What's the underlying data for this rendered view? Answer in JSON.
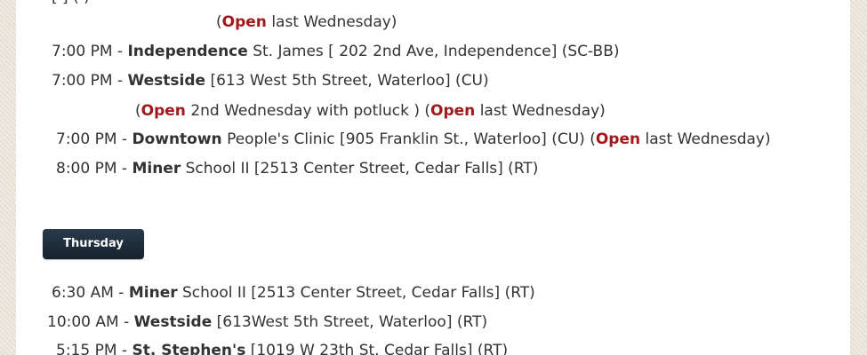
{
  "open_label": "Open",
  "top_cut_line": {
    "text": "                                      [                                ]  (  )"
  },
  "wednesday_items": [
    {
      "tail": "last Wednesday)"
    },
    {
      "time": "7:00 PM",
      "dash": " - ",
      "group": "Independence",
      "details": "St. James [ 202 2nd Ave, Independence] (SC-BB)"
    },
    {
      "time": "7:00 PM",
      "dash": "  - ",
      "group": "Westside",
      "details": "[613 West 5th Street, Waterloo] (CU)",
      "note_1": "2nd Wednesday with potluck ) (",
      "note_2": "last Wednesday)"
    },
    {
      "time": "7:00 PM",
      "dash": " - ",
      "group": "Downtown",
      "details": "People's Clinic [905 Franklin St., Waterloo]  (CU)  (",
      "tail": "last Wednesday)"
    },
    {
      "time": "8:00 PM",
      "dash": " - ",
      "group": "Miner",
      "details": "School II [2513 Center Street, Cedar Falls] (RT)"
    }
  ],
  "thursday_button": "Thursday",
  "thursday_items": [
    {
      "time": "6:30 AM",
      "dash": " - ",
      "group": "Miner",
      "details": "School II [2513 Center Street, Cedar Falls] (RT)"
    },
    {
      "time": "10:00 AM",
      "dash": " - ",
      "group": "Westside",
      "details": "[613West 5th Street, Waterloo]  (RT)"
    },
    {
      "time": "5:15 PM",
      "dash": " - ",
      "group": "St. Stephen's",
      "details": "[1019 W 23th St. Cedar Falls] (RT)"
    }
  ]
}
